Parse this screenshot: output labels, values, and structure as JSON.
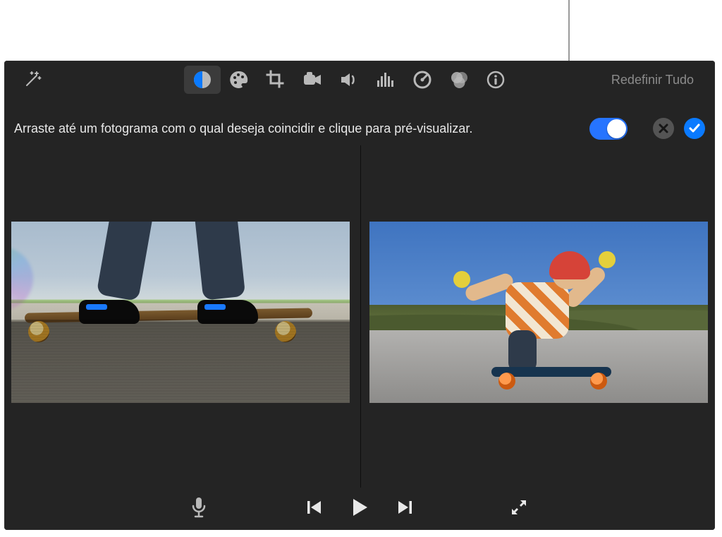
{
  "callout": {
    "present": true
  },
  "toolbar": {
    "wand": "magic-wand",
    "items": [
      {
        "id": "color-balance",
        "active": true
      },
      {
        "id": "color-wheel",
        "active": false
      },
      {
        "id": "crop",
        "active": false
      },
      {
        "id": "stabilize",
        "active": false
      },
      {
        "id": "volume",
        "active": false
      },
      {
        "id": "equalizer",
        "active": false
      },
      {
        "id": "speed",
        "active": false
      },
      {
        "id": "filters",
        "active": false
      },
      {
        "id": "info",
        "active": false
      }
    ],
    "reset_label": "Redefinir Tudo"
  },
  "subbar": {
    "instruction": "Arraste até um fotograma com o qual deseja coincidir e clique para pré-visualizar.",
    "toggle_on": true,
    "cancel": "cancel",
    "accept": "accept"
  },
  "previews": {
    "left": {
      "desc": "skateboard-wheels-on-road"
    },
    "right": {
      "desc": "skater-crouching-downhill"
    }
  },
  "playbar": {
    "mic": "microphone",
    "prev": "previous-frame",
    "play": "play",
    "next": "next-frame",
    "fullscreen": "fullscreen"
  },
  "colors": {
    "accent": "#0a7aff",
    "panel": "#242424"
  }
}
